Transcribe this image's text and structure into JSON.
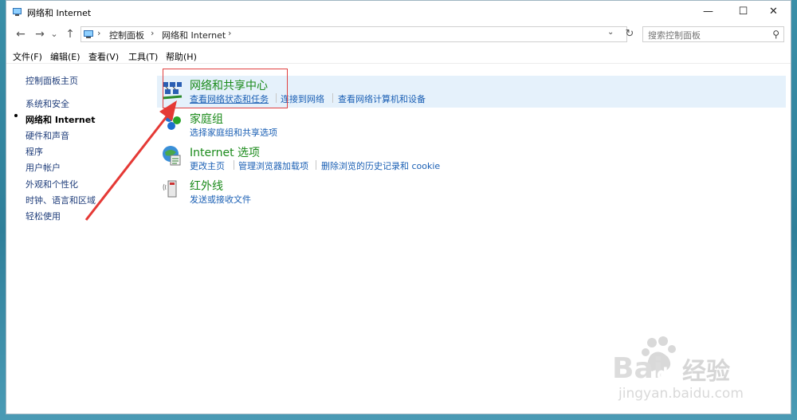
{
  "window": {
    "title": "网络和 Internet",
    "minimize_glyph": "—",
    "maximize_glyph": "☐",
    "close_glyph": "✕"
  },
  "navigation": {
    "back": "←",
    "forward": "→",
    "recent": "⌄",
    "up": "↑",
    "breadcrumbs": [
      "控制面板",
      "网络和 Internet"
    ],
    "separator": "›",
    "dropdown": "⌄",
    "refresh": "↻"
  },
  "search": {
    "placeholder": "搜索控制面板",
    "icon": "search-icon"
  },
  "menubar": [
    "文件(F)",
    "编辑(E)",
    "查看(V)",
    "工具(T)",
    "帮助(H)"
  ],
  "sidebar": {
    "items": [
      "控制面板主页",
      "系统和安全",
      "网络和 Internet",
      "硬件和声音",
      "程序",
      "用户帐户",
      "外观和个性化",
      "时钟、语言和区域",
      "轻松使用"
    ],
    "active": "网络和 Internet"
  },
  "categories": [
    {
      "title": "网络和共享中心",
      "icon": "network-sharing-icon",
      "links": [
        "查看网络状态和任务",
        "连接到网络",
        "查看网络计算机和设备"
      ]
    },
    {
      "title": "家庭组",
      "icon": "homegroup-icon",
      "links": [
        "选择家庭组和共享选项"
      ]
    },
    {
      "title": "Internet 选项",
      "icon": "internet-options-icon",
      "links": [
        "更改主页",
        "管理浏览器加载项",
        "删除浏览的历史记录和 cookie"
      ]
    },
    {
      "title": "红外线",
      "icon": "infrared-icon",
      "links": [
        "发送或接收文件"
      ]
    }
  ],
  "watermark": {
    "brand_cn": "经验",
    "url": "jingyan.baidu.com"
  },
  "colors": {
    "category_title": "#1a8a1a",
    "link": "#1a5fb4",
    "highlight": "#e5f1fb",
    "annotation": "#e04040"
  }
}
